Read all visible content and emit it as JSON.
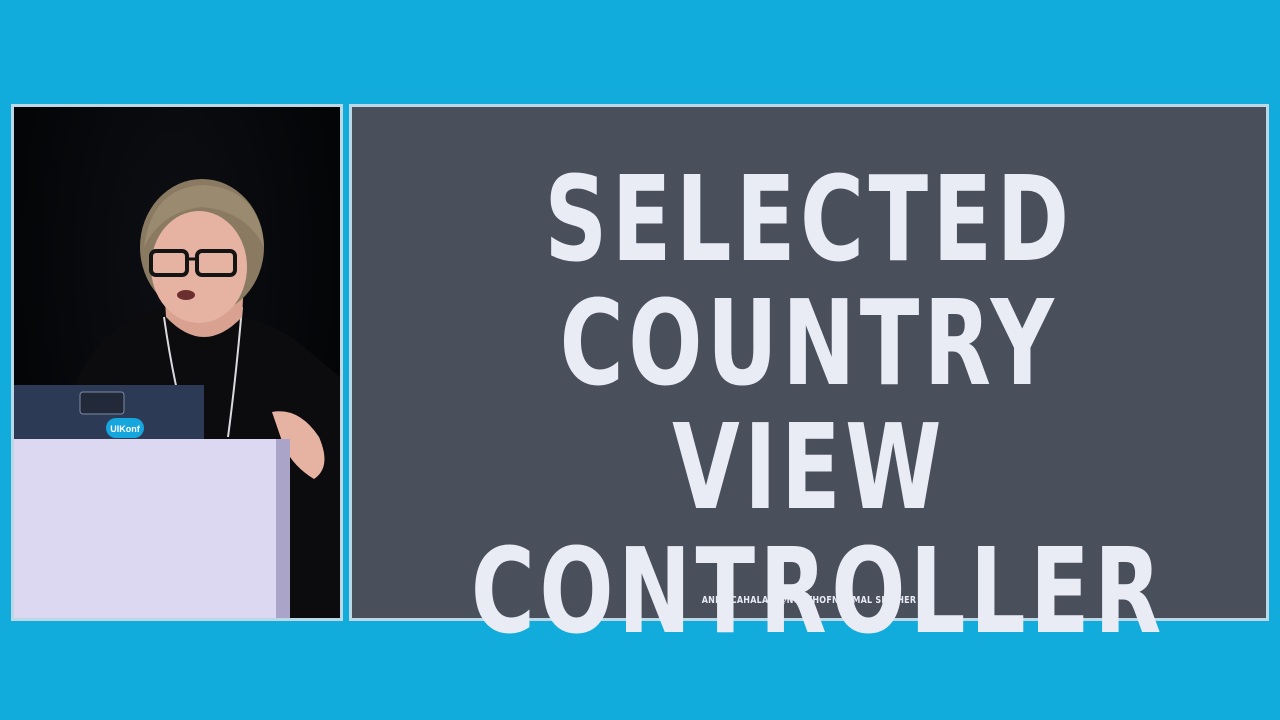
{
  "slide": {
    "title_lines": [
      "SELECTED",
      "COUNTRY VIEW",
      "CONTROLLER"
    ],
    "credit": "ANNE CAHALAN @NORTHOFNORMAL SHE/HER"
  },
  "video": {
    "laptop_sticker": "UIKonf"
  },
  "colors": {
    "background": "#11acdc",
    "slide_bg": "#4a4f5c",
    "slide_text": "#e9ebf5",
    "panel_border": "#bcd8e6"
  }
}
